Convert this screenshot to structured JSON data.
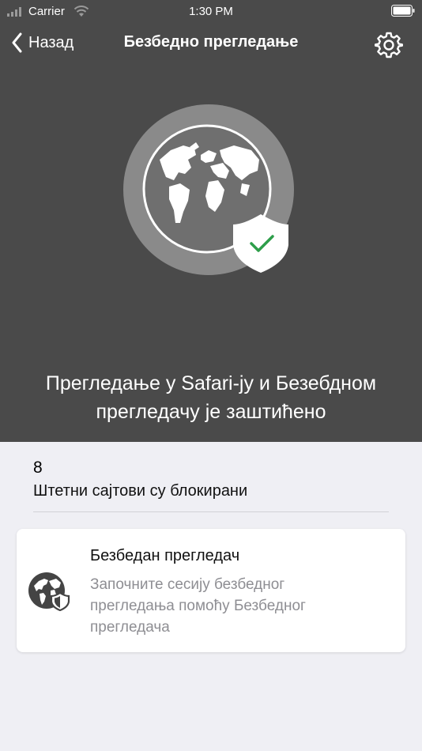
{
  "status_bar": {
    "carrier": "Carrier",
    "time": "1:30 PM"
  },
  "nav": {
    "back_label": "Назад",
    "title": "Безбедно прегледање"
  },
  "hero": {
    "message": "Прегледање у Safari-ју и Безебдном прегледачу је заштићено"
  },
  "stats": {
    "blocked_count": "8",
    "blocked_label": "Штетни сајтови су блокирани"
  },
  "card": {
    "title": "Безбедан прегледач",
    "description": "Започните сесију безбедног прегледања помоћу Безбедног прегледача"
  },
  "colors": {
    "hero_bg": "#4a4a4a",
    "page_bg": "#efeff4",
    "check_green": "#2e9e4a"
  },
  "icons": {
    "back": "chevron-left-icon",
    "settings": "gear-icon",
    "hero": "globe-shield-icon",
    "card": "globe-shield-icon"
  }
}
